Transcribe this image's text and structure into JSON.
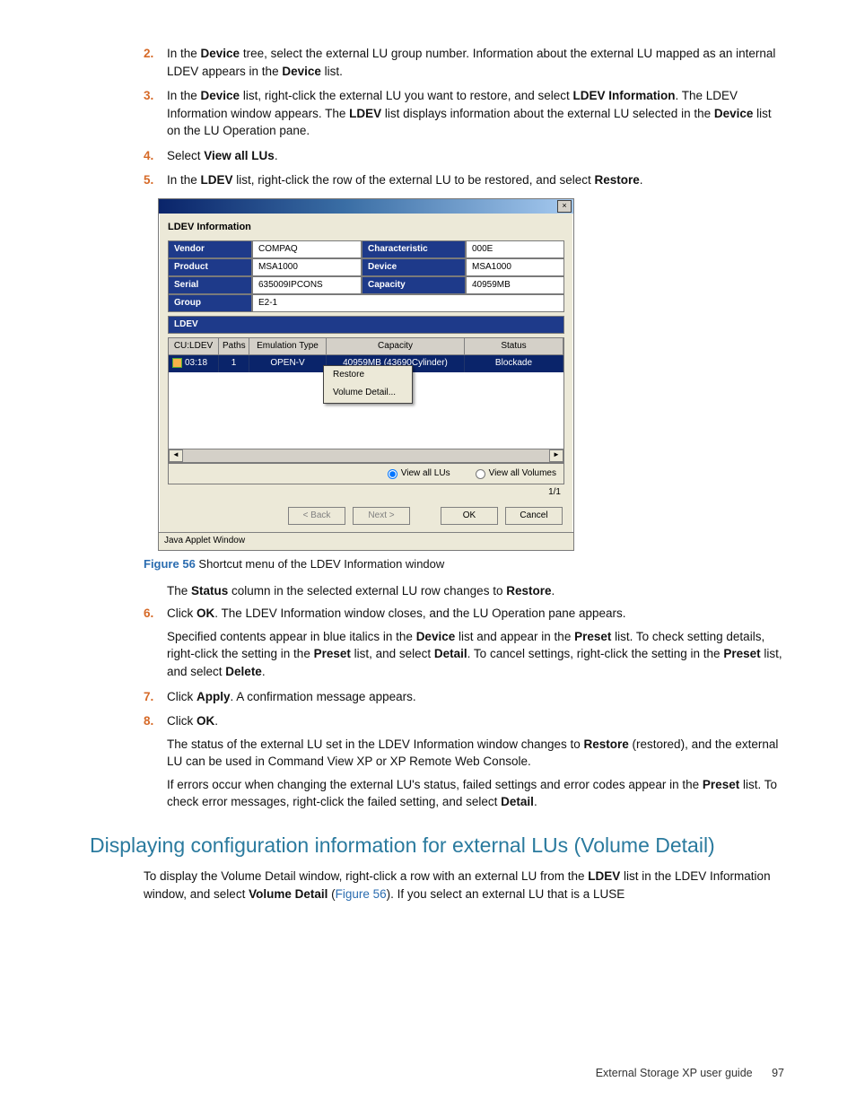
{
  "steps": {
    "s2": {
      "num": "2.",
      "pre": "In the ",
      "b1": "Device",
      "mid1": " tree, select the external LU group number. Information about the external LU mapped as an internal LDEV appears in the ",
      "b2": "Device",
      "end": " list."
    },
    "s3": {
      "num": "3.",
      "pre": "In the ",
      "b1": "Device",
      "mid1": " list, right-click the external LU you want to restore, and select ",
      "b2": "LDEV Information",
      "mid2": ". The LDEV Information window appears. The ",
      "b3": "LDEV",
      "mid3": " list displays information about the external LU selected in the ",
      "b4": "Device",
      "end": " list on the LU Operation pane."
    },
    "s4": {
      "num": "4.",
      "pre": "Select ",
      "b1": "View all LUs",
      "end": "."
    },
    "s5": {
      "num": "5.",
      "pre": "In the ",
      "b1": "LDEV",
      "mid1": " list, right-click the row of the external LU to be restored, and select ",
      "b2": "Restore",
      "end": "."
    },
    "s6": {
      "num": "6.",
      "pre": "Click ",
      "b1": "OK",
      "end": ". The LDEV Information window closes, and the LU Operation pane appears."
    },
    "s7": {
      "num": "7.",
      "pre": "Click ",
      "b1": "Apply",
      "end": ". A confirmation message appears."
    },
    "s8": {
      "num": "8.",
      "pre": "Click ",
      "b1": "OK",
      "end": "."
    }
  },
  "afterfig": {
    "caption_label": "Figure 56",
    "caption_text": " Shortcut menu of the LDEV Information window",
    "status_pre": "The ",
    "status_b1": "Status",
    "status_mid": " column in the selected external LU row changes to ",
    "status_b2": "Restore",
    "status_end": ".",
    "p6a_pre": "Specified contents appear in blue italics in the ",
    "p6a_b1": "Device",
    "p6a_mid1": " list and appear in the ",
    "p6a_b2": "Preset",
    "p6a_mid2": " list. To check setting details, right-click the setting in the ",
    "p6a_b3": "Preset",
    "p6a_mid3": " list, and select ",
    "p6a_b4": "Detail",
    "p6a_mid4": ". To cancel settings, right-click the setting in the ",
    "p6a_b5": "Preset",
    "p6a_mid5": " list, and select ",
    "p6a_b6": "Delete",
    "p6a_end": ".",
    "p8a_pre": "The status of the external LU set in the LDEV Information window changes to ",
    "p8a_b1": "Restore",
    "p8a_end": " (restored), and the external LU can be used in Command View XP or XP Remote Web Console.",
    "p8b_pre": "If errors occur when changing the external LU's status, failed settings and error codes appear in the ",
    "p8b_b1": "Preset",
    "p8b_mid": " list. To check error messages, right-click the failed setting, and select ",
    "p8b_b2": "Detail",
    "p8b_end": "."
  },
  "section_heading": "Displaying configuration information for external LUs (Volume Detail)",
  "sectpara": {
    "pre": "To display the Volume Detail window, right-click a row with an external LU from the ",
    "b1": "LDEV",
    "mid1": " list in the LDEV Information window, and select ",
    "b2": "Volume Detail",
    "mid2": " (",
    "link": "Figure 56",
    "end": "). If you select an external LU that is a LUSE"
  },
  "footer": {
    "title": "External Storage XP user guide",
    "page": "97"
  },
  "win": {
    "title_header": "LDEV Information",
    "close": "×",
    "kv": {
      "vendor_l": "Vendor",
      "vendor_v": "COMPAQ",
      "char_l": "Characteristic",
      "char_v": "000E",
      "product_l": "Product",
      "product_v": "MSA1000",
      "device_l": "Device",
      "device_v": "MSA1000",
      "serial_l": "Serial",
      "serial_v": "635009IPCONS",
      "capacity_l": "Capacity",
      "capacity_v": "40959MB",
      "group_l": "Group",
      "group_v": "E2-1",
      "ldev_l": "LDEV"
    },
    "thead": {
      "c1": "CU:LDEV",
      "c2": "Paths",
      "c3": "Emulation Type",
      "c4": "Capacity",
      "c5": "Status"
    },
    "row": {
      "c1": "03:18",
      "c2": "1",
      "c3": "OPEN-V",
      "c4": "40959MB (43690Cylinder)",
      "c5": "Blockade"
    },
    "ctx": {
      "restore": "Restore",
      "vdetail": "Volume Detail..."
    },
    "radio_lus": "View all LUs",
    "radio_vols": "View all Volumes",
    "page_ind": "1/1",
    "btn_back": "< Back",
    "btn_next": "Next >",
    "btn_ok": "OK",
    "btn_cancel": "Cancel",
    "status": "Java Applet Window"
  }
}
